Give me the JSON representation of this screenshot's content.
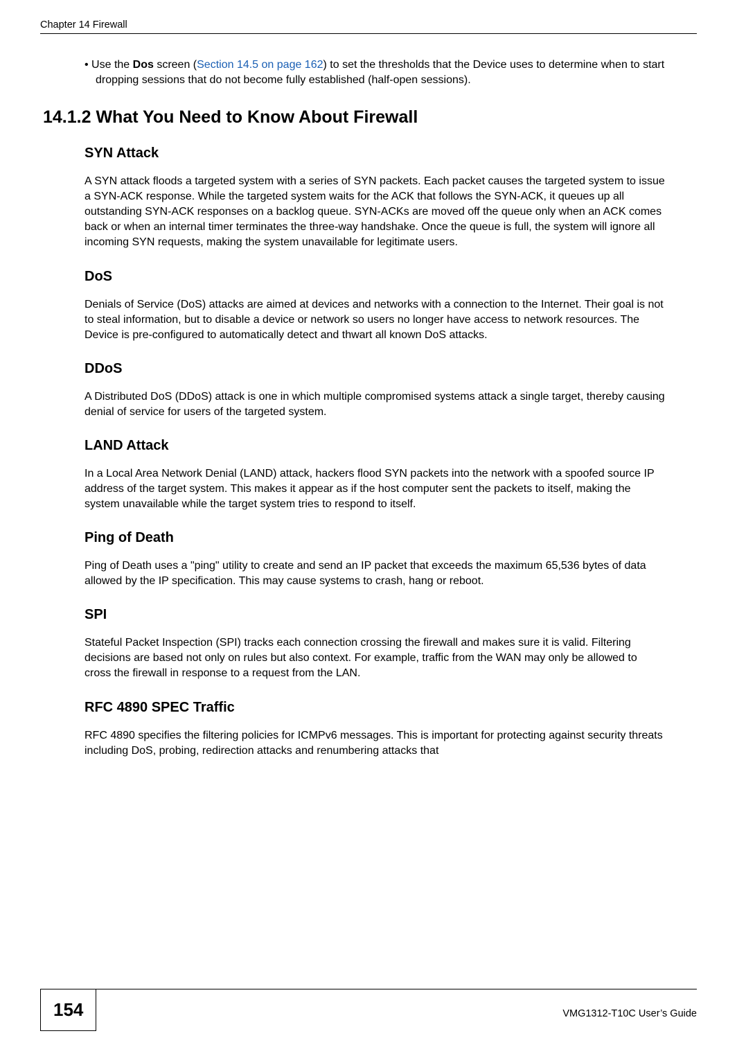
{
  "header": {
    "left": "Chapter 14 Firewall"
  },
  "bullet": {
    "prefix": "•  Use the ",
    "bold1": "Dos",
    "mid1": " screen (",
    "link": "Section 14.5 on page 162",
    "tail": ") to set the thresholds that the Device uses to determine when to start dropping sessions that do not become fully established (half-open sessions)."
  },
  "h2": "14.1.2  What You Need to Know About Firewall",
  "sections": {
    "syn": {
      "title": "SYN Attack",
      "body": "A SYN attack floods a targeted system with a series of SYN packets. Each packet causes the targeted system to issue a SYN-ACK response. While the targeted system waits for the ACK that follows the SYN-ACK, it queues up all outstanding SYN-ACK responses on a backlog queue. SYN-ACKs are moved off the queue only when an ACK comes back or when an internal timer terminates the three-way handshake. Once the queue is full, the system will ignore all incoming SYN requests, making the system unavailable for legitimate users."
    },
    "dos": {
      "title": "DoS",
      "body": "Denials of Service (DoS) attacks are aimed at devices and networks with a connection to the Internet. Their goal is not to steal information, but to disable a device or network so users no longer have access to network resources. The Device is pre-configured to automatically detect and thwart all known DoS attacks."
    },
    "ddos": {
      "title": "DDoS",
      "body": "A Distributed DoS (DDoS) attack is one in which multiple compromised systems attack a single target, thereby causing denial of service for users of the targeted system."
    },
    "land": {
      "title": "LAND Attack",
      "body": "In a Local Area Network Denial (LAND) attack, hackers flood SYN packets into the network with a spoofed source IP address of the target system. This makes it appear as if the host computer sent the packets to itself, making the system unavailable while the target system tries to respond to itself."
    },
    "pod": {
      "title": "Ping of Death",
      "body": "Ping of Death uses a \"ping\" utility to create and send an IP packet that exceeds the maximum 65,536 bytes of data allowed by the IP specification. This may cause systems to crash, hang or reboot."
    },
    "spi": {
      "title": "SPI",
      "body": "Stateful Packet Inspection (SPI) tracks each connection crossing the firewall and makes sure it is valid. Filtering decisions are based not only on rules but also context. For example, traffic from the WAN may only be allowed to cross the firewall in response to a request from the LAN."
    },
    "rfc": {
      "title": "RFC 4890 SPEC Traffic",
      "body": "RFC 4890 specifies the filtering policies for ICMPv6 messages.   This is important for protecting against security threats including DoS, probing, redirection attacks and renumbering attacks that"
    }
  },
  "footer": {
    "page": "154",
    "guide": "VMG1312-T10C User’s Guide"
  }
}
